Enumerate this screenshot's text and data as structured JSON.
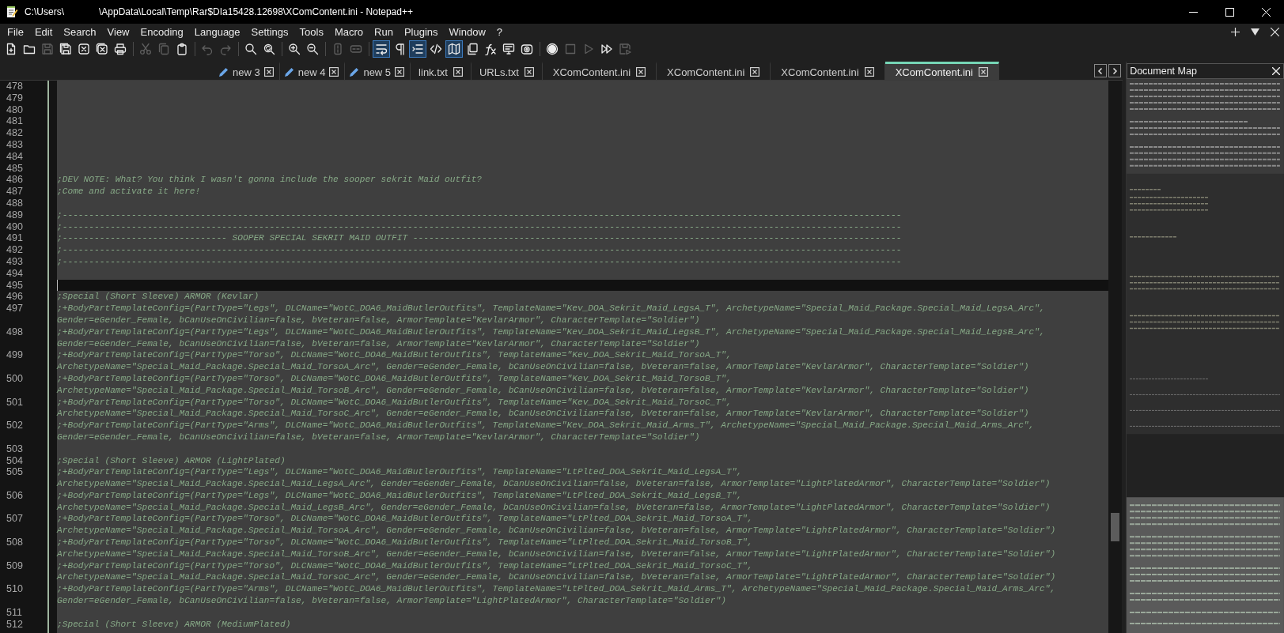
{
  "window": {
    "title_parts": [
      "C:\\Users\\",
      "\\AppData\\Local\\Temp\\Rar$DIa15428.12698\\XComContent.ini - Notepad++"
    ]
  },
  "menu": [
    "File",
    "Edit",
    "Search",
    "View",
    "Encoding",
    "Language",
    "Settings",
    "Tools",
    "Macro",
    "Run",
    "Plugins",
    "Window",
    "?"
  ],
  "toolbar": [
    [
      {
        "kind": "new",
        "disabled": false,
        "active": false
      },
      {
        "kind": "open",
        "disabled": false,
        "active": false
      },
      {
        "kind": "save",
        "disabled": true,
        "active": false
      },
      {
        "kind": "save-all",
        "disabled": false,
        "active": false
      },
      {
        "kind": "close",
        "disabled": false,
        "active": false
      },
      {
        "kind": "close-all",
        "disabled": false,
        "active": false
      },
      {
        "kind": "print",
        "disabled": false,
        "active": false
      }
    ],
    [
      {
        "kind": "cut",
        "disabled": true,
        "active": false
      },
      {
        "kind": "copy",
        "disabled": true,
        "active": false
      },
      {
        "kind": "paste",
        "disabled": false,
        "active": false
      }
    ],
    [
      {
        "kind": "undo",
        "disabled": true,
        "active": false
      },
      {
        "kind": "redo",
        "disabled": true,
        "active": false
      }
    ],
    [
      {
        "kind": "find",
        "disabled": false,
        "active": false
      },
      {
        "kind": "replace",
        "disabled": false,
        "active": false
      }
    ],
    [
      {
        "kind": "zoom-in",
        "disabled": false,
        "active": false
      },
      {
        "kind": "zoom-out",
        "disabled": false,
        "active": false
      }
    ],
    [
      {
        "kind": "sync-vertical",
        "disabled": true,
        "active": false
      },
      {
        "kind": "sync-horizontal",
        "disabled": true,
        "active": false
      }
    ],
    [
      {
        "kind": "word-wrap",
        "disabled": false,
        "active": true
      },
      {
        "kind": "all-chars",
        "disabled": false,
        "active": false
      },
      {
        "kind": "indent-guide",
        "disabled": false,
        "active": true
      },
      {
        "kind": "code",
        "disabled": false,
        "active": false
      },
      {
        "kind": "document-map",
        "disabled": false,
        "active": true
      },
      {
        "kind": "document-list",
        "disabled": false,
        "active": false
      },
      {
        "kind": "function-list",
        "disabled": false,
        "active": false
      },
      {
        "kind": "monitor",
        "disabled": false,
        "active": false
      },
      {
        "kind": "camera",
        "disabled": false,
        "active": false
      }
    ],
    [
      {
        "kind": "record",
        "disabled": false,
        "active": false
      },
      {
        "kind": "stop",
        "disabled": true,
        "active": false
      },
      {
        "kind": "play",
        "disabled": true,
        "active": false
      },
      {
        "kind": "play-multiple",
        "disabled": false,
        "active": false
      },
      {
        "kind": "save-macro",
        "disabled": true,
        "active": false
      }
    ]
  ],
  "tabs": [
    {
      "label": "new 3",
      "modified": true,
      "selected": false
    },
    {
      "label": "new 4",
      "modified": true,
      "selected": false
    },
    {
      "label": "new 5",
      "modified": true,
      "selected": false
    },
    {
      "label": "link.txt",
      "modified": false,
      "selected": false
    },
    {
      "label": "URLs.txt",
      "modified": false,
      "selected": false
    },
    {
      "label": "XComContent.ini",
      "modified": false,
      "selected": false
    },
    {
      "label": "XComContent.ini",
      "modified": false,
      "selected": false
    },
    {
      "label": "XComContent.ini",
      "modified": false,
      "selected": false
    },
    {
      "label": "XComContent.ini",
      "modified": false,
      "selected": true
    }
  ],
  "document_map": {
    "title": "Document Map"
  },
  "editor": {
    "lines": [
      {
        "number": "478",
        "current": false
      },
      {
        "number": "479",
        "current": false
      },
      {
        "number": "480",
        "current": false
      },
      {
        "number": "481",
        "current": false
      },
      {
        "number": "482",
        "current": false
      },
      {
        "number": "483",
        "current": false
      },
      {
        "number": "484",
        "current": false
      },
      {
        "number": "485",
        "current": false
      },
      {
        "number": "486",
        "current": false,
        "rows": [
          ";DEV NOTE: What? You think I wasn't gonna include the sooper sekrit Maid outfit?"
        ]
      },
      {
        "number": "487",
        "current": false,
        "rows": [
          ";Come and activate it here!"
        ]
      },
      {
        "number": "488",
        "current": false
      },
      {
        "number": "489",
        "current": false,
        "rows": [
          ";--------------------------------------------------------------------------------------------------------------------------------------------------------------"
        ]
      },
      {
        "number": "490",
        "current": false,
        "rows": [
          ";--------------------------------------------------------------------------------------------------------------------------------------------------------------"
        ]
      },
      {
        "number": "491",
        "current": false,
        "rows": [
          ";------------------------------- SOOPER SPECIAL SEKRIT MAID OUTFIT --------------------------------------------------------------------------------------------"
        ]
      },
      {
        "number": "492",
        "current": false,
        "rows": [
          ";--------------------------------------------------------------------------------------------------------------------------------------------------------------"
        ]
      },
      {
        "number": "493",
        "current": false,
        "rows": [
          ";--------------------------------------------------------------------------------------------------------------------------------------------------------------"
        ]
      },
      {
        "number": "494",
        "current": false
      },
      {
        "number": "495",
        "current": true
      },
      {
        "number": "496",
        "current": false,
        "rows": [
          ";Special (Short Sleeve) ARMOR (Kevlar)"
        ]
      },
      {
        "number": "497",
        "current": false,
        "rows": [
          ";+BodyPartTemplateConfig=(PartType=\"Legs\", DLCName=\"WotC_DOA6_MaidButlerOutfits\", TemplateName=\"Kev_DOA_Sekrit_Maid_LegsA_T\", ArchetypeName=\"Special_Maid_Package.Special_Maid_LegsA_Arc\",",
          "Gender=eGender_Female, bCanUseOnCivilian=false, bVeteran=false, ArmorTemplate=\"KevlarArmor\", CharacterTemplate=\"Soldier\")"
        ]
      },
      {
        "number": "498",
        "current": false,
        "rows": [
          ";+BodyPartTemplateConfig=(PartType=\"Legs\", DLCName=\"WotC_DOA6_MaidButlerOutfits\", TemplateName=\"Kev_DOA_Sekrit_Maid_LegsB_T\", ArchetypeName=\"Special_Maid_Package.Special_Maid_LegsB_Arc\",",
          "Gender=eGender_Female, bCanUseOnCivilian=false, bVeteran=false, ArmorTemplate=\"KevlarArmor\", CharacterTemplate=\"Soldier\")"
        ]
      },
      {
        "number": "499",
        "current": false,
        "rows": [
          ";+BodyPartTemplateConfig=(PartType=\"Torso\", DLCName=\"WotC_DOA6_MaidButlerOutfits\", TemplateName=\"Kev_DOA_Sekrit_Maid_TorsoA_T\",",
          "ArchetypeName=\"Special_Maid_Package.Special_Maid_TorsoA_Arc\", Gender=eGender_Female, bCanUseOnCivilian=false, bVeteran=false, ArmorTemplate=\"KevlarArmor\", CharacterTemplate=\"Soldier\")"
        ]
      },
      {
        "number": "500",
        "current": false,
        "rows": [
          ";+BodyPartTemplateConfig=(PartType=\"Torso\", DLCName=\"WotC_DOA6_MaidButlerOutfits\", TemplateName=\"Kev_DOA_Sekrit_Maid_TorsoB_T\",",
          "ArchetypeName=\"Special_Maid_Package.Special_Maid_TorsoB_Arc\", Gender=eGender_Female, bCanUseOnCivilian=false, bVeteran=false, ArmorTemplate=\"KevlarArmor\", CharacterTemplate=\"Soldier\")"
        ]
      },
      {
        "number": "501",
        "current": false,
        "rows": [
          ";+BodyPartTemplateConfig=(PartType=\"Torso\", DLCName=\"WotC_DOA6_MaidButlerOutfits\", TemplateName=\"Kev_DOA_Sekrit_Maid_TorsoC_T\",",
          "ArchetypeName=\"Special_Maid_Package.Special_Maid_TorsoC_Arc\", Gender=eGender_Female, bCanUseOnCivilian=false, bVeteran=false, ArmorTemplate=\"KevlarArmor\", CharacterTemplate=\"Soldier\")"
        ]
      },
      {
        "number": "502",
        "current": false,
        "rows": [
          ";+BodyPartTemplateConfig=(PartType=\"Arms\", DLCName=\"WotC_DOA6_MaidButlerOutfits\", TemplateName=\"Kev_DOA_Sekrit_Maid_Arms_T\", ArchetypeName=\"Special_Maid_Package.Special_Maid_Arms_Arc\",",
          "Gender=eGender_Female, bCanUseOnCivilian=false, bVeteran=false, ArmorTemplate=\"KevlarArmor\", CharacterTemplate=\"Soldier\")"
        ]
      },
      {
        "number": "503",
        "current": false
      },
      {
        "number": "504",
        "current": false,
        "rows": [
          ";Special (Short Sleeve) ARMOR (LightPlated)"
        ]
      },
      {
        "number": "505",
        "current": false,
        "rows": [
          ";+BodyPartTemplateConfig=(PartType=\"Legs\", DLCName=\"WotC_DOA6_MaidButlerOutfits\", TemplateName=\"LtPlted_DOA_Sekrit_Maid_LegsA_T\",",
          "ArchetypeName=\"Special_Maid_Package.Special_Maid_LegsA_Arc\", Gender=eGender_Female, bCanUseOnCivilian=false, bVeteran=false, ArmorTemplate=\"LightPlatedArmor\", CharacterTemplate=\"Soldier\")"
        ]
      },
      {
        "number": "506",
        "current": false,
        "rows": [
          ";+BodyPartTemplateConfig=(PartType=\"Legs\", DLCName=\"WotC_DOA6_MaidButlerOutfits\", TemplateName=\"LtPlted_DOA_Sekrit_Maid_LegsB_T\",",
          "ArchetypeName=\"Special_Maid_Package.Special_Maid_LegsB_Arc\", Gender=eGender_Female, bCanUseOnCivilian=false, bVeteran=false, ArmorTemplate=\"LightPlatedArmor\", CharacterTemplate=\"Soldier\")"
        ]
      },
      {
        "number": "507",
        "current": false,
        "rows": [
          ";+BodyPartTemplateConfig=(PartType=\"Torso\", DLCName=\"WotC_DOA6_MaidButlerOutfits\", TemplateName=\"LtPlted_DOA_Sekrit_Maid_TorsoA_T\",",
          "ArchetypeName=\"Special_Maid_Package.Special_Maid_TorsoA_Arc\", Gender=eGender_Female, bCanUseOnCivilian=false, bVeteran=false, ArmorTemplate=\"LightPlatedArmor\", CharacterTemplate=\"Soldier\")"
        ]
      },
      {
        "number": "508",
        "current": false,
        "rows": [
          ";+BodyPartTemplateConfig=(PartType=\"Torso\", DLCName=\"WotC_DOA6_MaidButlerOutfits\", TemplateName=\"LtPlted_DOA_Sekrit_Maid_TorsoB_T\",",
          "ArchetypeName=\"Special_Maid_Package.Special_Maid_TorsoB_Arc\", Gender=eGender_Female, bCanUseOnCivilian=false, bVeteran=false, ArmorTemplate=\"LightPlatedArmor\", CharacterTemplate=\"Soldier\")"
        ]
      },
      {
        "number": "509",
        "current": false,
        "rows": [
          ";+BodyPartTemplateConfig=(PartType=\"Torso\", DLCName=\"WotC_DOA6_MaidButlerOutfits\", TemplateName=\"LtPlted_DOA_Sekrit_Maid_TorsoC_T\",",
          "ArchetypeName=\"Special_Maid_Package.Special_Maid_TorsoC_Arc\", Gender=eGender_Female, bCanUseOnCivilian=false, bVeteran=false, ArmorTemplate=\"LightPlatedArmor\", CharacterTemplate=\"Soldier\")"
        ]
      },
      {
        "number": "510",
        "current": false,
        "rows": [
          ";+BodyPartTemplateConfig=(PartType=\"Arms\", DLCName=\"WotC_DOA6_MaidButlerOutfits\", TemplateName=\"LtPlted_DOA_Sekrit_Maid_Arms_T\", ArchetypeName=\"Special_Maid_Package.Special_Maid_Arms_Arc\",",
          "Gender=eGender_Female, bCanUseOnCivilian=false, bVeteran=false, ArmorTemplate=\"LightPlatedArmor\", CharacterTemplate=\"Soldier\")"
        ]
      },
      {
        "number": "511",
        "current": false
      },
      {
        "number": "512",
        "current": false,
        "rows": [
          ";Special (Short Sleeve) ARMOR (MediumPlated)"
        ]
      }
    ]
  }
}
